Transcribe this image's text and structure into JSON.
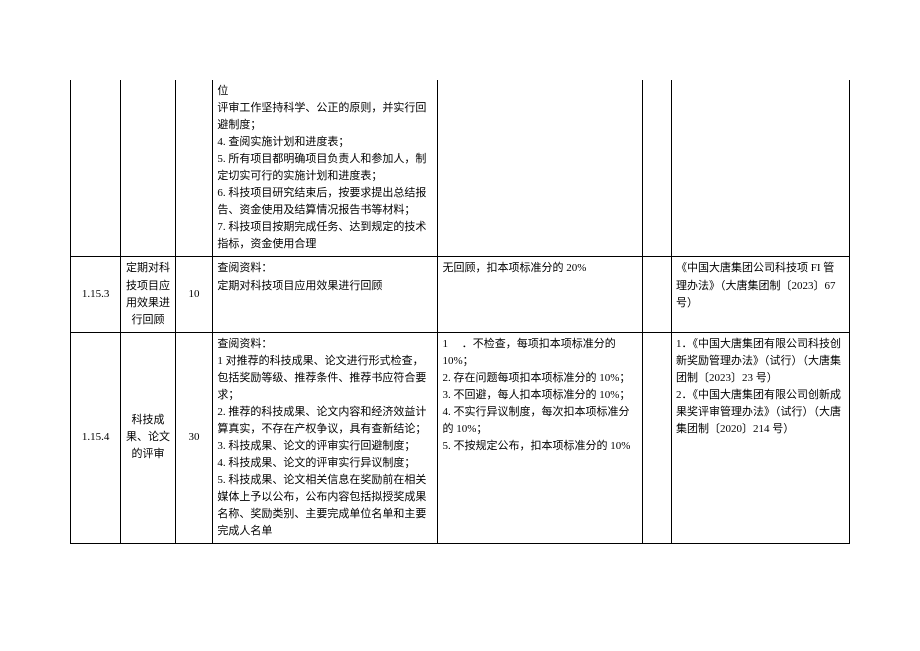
{
  "rows": {
    "r0": {
      "check": "位\n评审工作坚持科学、公正的原则，并实行回避制度；\n4. 查阅实施计划和进度表；\n5. 所有项目都明确项目负责人和参加人，制定切实可行的实施计划和进度表；\n6. 科技项目研究结束后，按要求提出总结报告、资金使用及结算情况报告书等材料；\n7. 科技项目按期完成任务、达到规定的技术指标，资金使用合理"
    },
    "r1": {
      "num": "1.15.3",
      "name": "定期对科技项目应用效果进行回顾",
      "score": "10",
      "check": "查阅资料：\n定期对科技项目应用效果进行回顾",
      "deduct": "无回顾，扣本项标准分的 20%",
      "ref": "《中国大唐集团公司科技项 FI 管理办法》（大唐集团制〔2023〕67 号）"
    },
    "r2": {
      "num": "1.15.4",
      "name": "科技成果、论文的评审",
      "score": "30",
      "check": "查阅资料：\n1 对推荐的科技成果、论文进行形式检查，包括奖励等级、推荐条件、推荐书应符合要求；\n2. 推荐的科技成果、论文内容和经济效益计算真实，不存在产权争议，具有查新结论；\n3. 科技成果、论文的评审实行回避制度；\n4. 科技成果、论文的评审实行异议制度；\n5. 科技成果、论文相关信息在奖励前在相关媒体上予以公布，公布内容包括拟授奖成果名称、奖励类别、主要完成单位名单和主要完成人名单",
      "deduct": "1 　．不检查，每项扣本项标准分的 10%；\n2. 存在问题每项扣本项标准分的 10%；\n3. 不回避，每人扣本项标准分的 10%；\n4. 不实行异议制度，每次扣本项标准分的 10%；\n5. 不按规定公布，扣本项标准分的 10%",
      "ref": "1．《中国大唐集团有限公司科技创新奖励管理办法》（试行）（大唐集团制〔2023〕23 号）\n2．《中国大唐集团有限公司创新成果奖评审管理办法》（试行）（大唐集团制〔2020〕214 号）"
    }
  }
}
